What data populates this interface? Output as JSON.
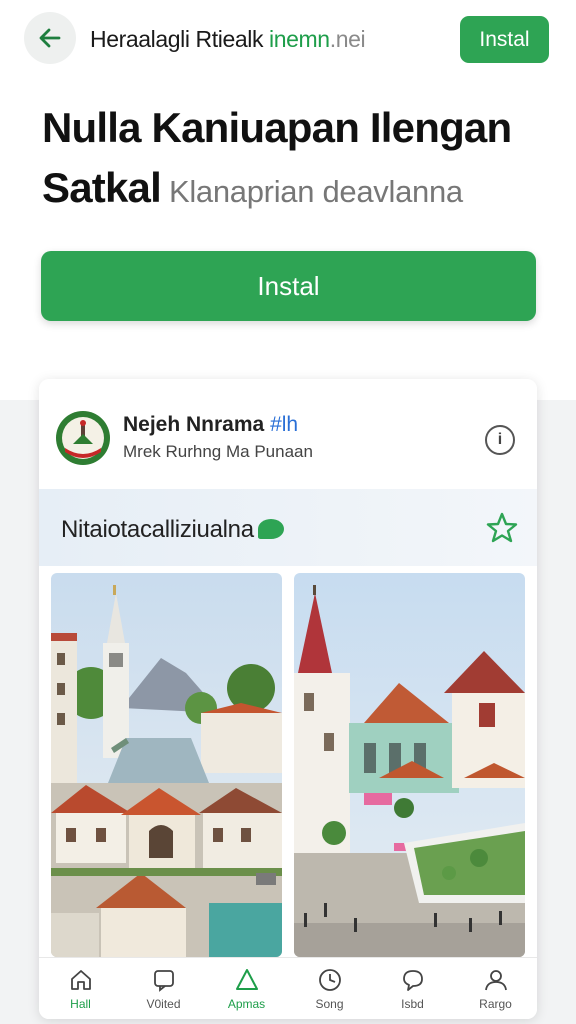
{
  "topbar": {
    "back_icon": "arrow-left-icon",
    "url_part1": "Heraalagli Rtiealk ",
    "url_part2": "inemn",
    "url_part3": ".nei",
    "install_label": "Instal",
    "accent_color": "#2ea454"
  },
  "hero": {
    "title_line1": "Nulla Kaniuapan Ilengan",
    "title_line2": "Satkal",
    "subtitle": "Klanaprian deavlanna",
    "install_label": "Instal"
  },
  "app": {
    "name": "Nejeh Nnrama ",
    "name_accent": "#lh",
    "developer": "Mrek Rurhng Ma Punaan",
    "info_icon": "info-icon",
    "info_glyph": "i"
  },
  "banner": {
    "text": "Nitaiotacalliziualna",
    "leaf_icon": "leaf-icon",
    "star_icon": "star-icon"
  },
  "screenshots": [
    {
      "name": "screenshot-canal-town"
    },
    {
      "name": "screenshot-town-square"
    }
  ],
  "nav": {
    "items": [
      {
        "label": "Hall",
        "icon": "home-icon"
      },
      {
        "label": "V0ited",
        "icon": "chat-icon"
      },
      {
        "label": "Apmas",
        "icon": "apps-icon"
      },
      {
        "label": "Song",
        "icon": "clock-icon"
      },
      {
        "label": "Isbd",
        "icon": "message-icon"
      },
      {
        "label": "Rargo",
        "icon": "profile-icon"
      }
    ]
  }
}
